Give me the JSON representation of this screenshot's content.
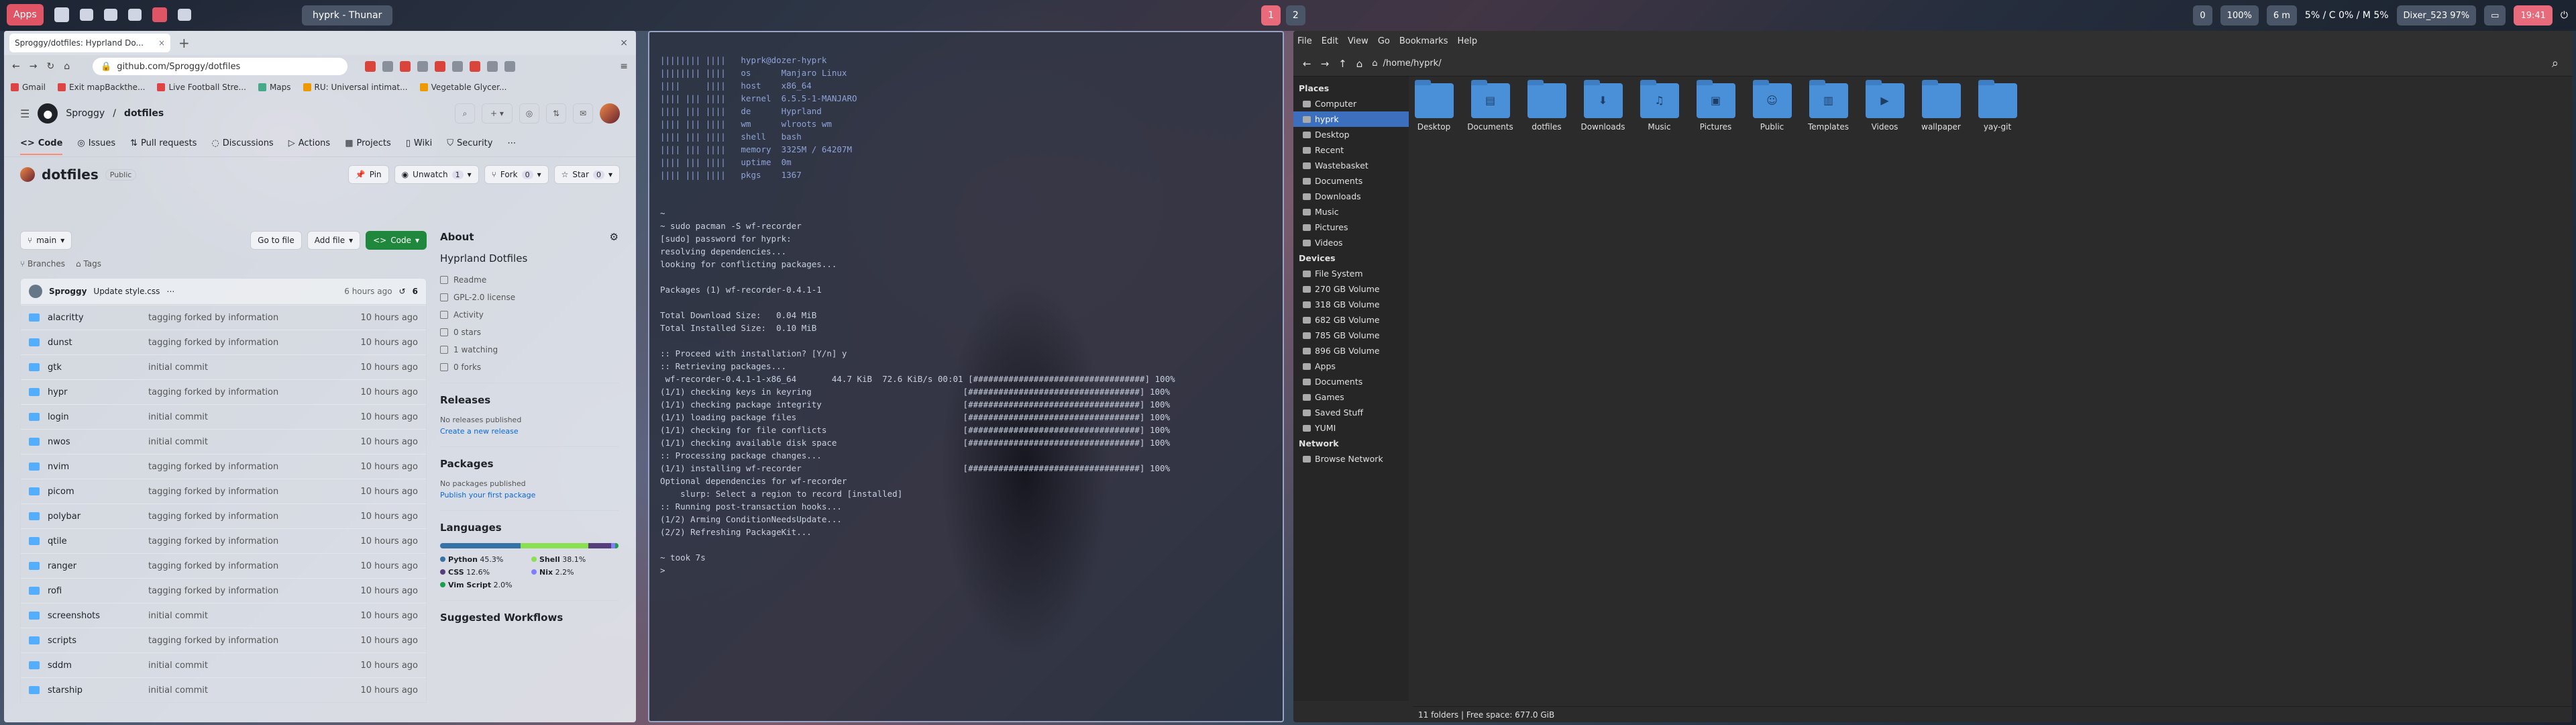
{
  "topbar": {
    "apps": "Apps",
    "window_title": "hyprk - Thunar",
    "workspace_pages": [
      "1",
      "2"
    ],
    "status_items": [
      "0",
      "100%",
      "6 m",
      "5% / C 0% / M 5%",
      "Dixer_523 97%"
    ],
    "clock": "19:41"
  },
  "browser": {
    "tab_title": "Sproggy/dotfiles: Hyprland Do...",
    "url": "github.com/Sproggy/dotfiles",
    "bookmarks": [
      "Gmail",
      "Exit mapBackthe...",
      "Live Football Stre...",
      "Maps",
      "RU: Universal intimat...",
      "Vegetable Glycer..."
    ],
    "gh": {
      "owner": "Sproggy",
      "repo": "dotfiles",
      "tabs": [
        "Code",
        "Issues",
        "Pull requests",
        "Discussions",
        "Actions",
        "Projects",
        "Wiki",
        "Security"
      ],
      "repo_title": "dotfiles",
      "visibility": "Public",
      "pin": "Pin",
      "unwatch": "Unwatch",
      "watch_count": "1",
      "fork": "Fork",
      "fork_count": "0",
      "star": "Star",
      "star_count": "0",
      "branch": "main",
      "branches": "Branches",
      "tags": "Tags",
      "goto_file": "Go to file",
      "add_file": "Add file",
      "code_btn": "Code",
      "commit": {
        "author": "Sproggy",
        "message": "Update style.css",
        "age": "6 hours ago",
        "count": "6"
      },
      "files": [
        {
          "name": "alacritty",
          "msg": "tagging forked by information",
          "age": "10 hours ago"
        },
        {
          "name": "dunst",
          "msg": "tagging forked by information",
          "age": "10 hours ago"
        },
        {
          "name": "gtk",
          "msg": "initial commit",
          "age": "10 hours ago"
        },
        {
          "name": "hypr",
          "msg": "tagging forked by information",
          "age": "10 hours ago"
        },
        {
          "name": "login",
          "msg": "initial commit",
          "age": "10 hours ago"
        },
        {
          "name": "nwos",
          "msg": "initial commit",
          "age": "10 hours ago"
        },
        {
          "name": "nvim",
          "msg": "tagging forked by information",
          "age": "10 hours ago"
        },
        {
          "name": "picom",
          "msg": "tagging forked by information",
          "age": "10 hours ago"
        },
        {
          "name": "polybar",
          "msg": "tagging forked by information",
          "age": "10 hours ago"
        },
        {
          "name": "qtile",
          "msg": "tagging forked by information",
          "age": "10 hours ago"
        },
        {
          "name": "ranger",
          "msg": "tagging forked by information",
          "age": "10 hours ago"
        },
        {
          "name": "rofi",
          "msg": "tagging forked by information",
          "age": "10 hours ago"
        },
        {
          "name": "screenshots",
          "msg": "initial commit",
          "age": "10 hours ago"
        },
        {
          "name": "scripts",
          "msg": "tagging forked by information",
          "age": "10 hours ago"
        },
        {
          "name": "sddm",
          "msg": "initial commit",
          "age": "10 hours ago"
        },
        {
          "name": "starship",
          "msg": "initial commit",
          "age": "10 hours ago"
        }
      ],
      "about": {
        "title": "About",
        "desc": "Hyprland Dotfiles",
        "readme": "Readme",
        "license": "GPL-2.0 license",
        "activity": "Activity",
        "stars": "0 stars",
        "watching": "1 watching",
        "forks": "0 forks"
      },
      "releases": {
        "title": "Releases",
        "none": "No releases published",
        "create": "Create a new release"
      },
      "packages": {
        "title": "Packages",
        "none": "No packages published",
        "publish": "Publish your first package"
      },
      "languages": {
        "title": "Languages",
        "items": [
          {
            "name": "Python",
            "pct": "45.3%",
            "value": 45.3,
            "color": "#3572A5"
          },
          {
            "name": "Shell",
            "pct": "38.1%",
            "value": 38.1,
            "color": "#89e051"
          },
          {
            "name": "CSS",
            "pct": "12.6%",
            "value": 12.6,
            "color": "#563d7c"
          },
          {
            "name": "Nix",
            "pct": "2.2%",
            "value": 2.2,
            "color": "#7e7eff"
          },
          {
            "name": "Vim Script",
            "pct": "2.0%",
            "value": 2.0,
            "color": "#199f4b"
          }
        ]
      },
      "suggested": "Suggested Workflows"
    }
  },
  "terminal": {
    "neofetch": [
      "|||||||| ||||   hyprk@dozer-hyprk",
      "|||||||| ||||   os      Manjaro Linux",
      "||||     ||||   host    x86_64",
      "|||| ||| ||||   kernel  6.5.5-1-MANJARO",
      "|||| ||| ||||   de      Hyprland",
      "|||| ||| ||||   wm      wlroots wm",
      "|||| ||| ||||   shell   bash",
      "|||| ||| ||||   memory  3325M / 64207M",
      "|||| ||| ||||   uptime  0m",
      "|||| ||| ||||   pkgs    1367"
    ],
    "lines": [
      "~",
      "~ sudo pacman -S wf-recorder",
      "[sudo] password for hyprk:",
      "resolving dependencies...",
      "looking for conflicting packages...",
      "",
      "Packages (1) wf-recorder-0.4.1-1",
      "",
      "Total Download Size:   0.04 MiB",
      "Total Installed Size:  0.10 MiB",
      "",
      ":: Proceed with installation? [Y/n] y",
      ":: Retrieving packages...",
      " wf-recorder-0.4.1-1-x86_64       44.7 KiB  72.6 KiB/s 00:01 [##################################] 100%",
      "(1/1) checking keys in keyring                              [##################################] 100%",
      "(1/1) checking package integrity                            [##################################] 100%",
      "(1/1) loading package files                                 [##################################] 100%",
      "(1/1) checking for file conflicts                           [##################################] 100%",
      "(1/1) checking available disk space                         [##################################] 100%",
      ":: Processing package changes...",
      "(1/1) installing wf-recorder                                [##################################] 100%",
      "Optional dependencies for wf-recorder",
      "    slurp: Select a region to record [installed]",
      ":: Running post-transaction hooks...",
      "(1/2) Arming ConditionNeedsUpdate...",
      "(2/2) Refreshing PackageKit...",
      "",
      "~ took 7s",
      "> "
    ]
  },
  "filemgr": {
    "menu": [
      "File",
      "Edit",
      "View",
      "Go",
      "Bookmarks",
      "Help"
    ],
    "path": "/home/hyprk/",
    "places_title": "Places",
    "places": [
      "Computer",
      "hyprk",
      "Desktop",
      "Recent",
      "Wastebasket",
      "Documents",
      "Downloads",
      "Music",
      "Pictures",
      "Videos"
    ],
    "devices_title": "Devices",
    "devices": [
      "File System",
      "270 GB Volume",
      "318 GB Volume",
      "682 GB Volume",
      "785 GB Volume",
      "896 GB Volume",
      "Apps",
      "Documents",
      "Games",
      "Saved Stuff",
      "YUMI"
    ],
    "network_title": "Network",
    "network": [
      "Browse Network"
    ],
    "folders": [
      {
        "name": "Desktop",
        "glyph": ""
      },
      {
        "name": "Documents",
        "glyph": "▤"
      },
      {
        "name": "dotfiles",
        "glyph": ""
      },
      {
        "name": "Downloads",
        "glyph": "⬇"
      },
      {
        "name": "Music",
        "glyph": "♫"
      },
      {
        "name": "Pictures",
        "glyph": "▣"
      },
      {
        "name": "Public",
        "glyph": "☺"
      },
      {
        "name": "Templates",
        "glyph": "▥"
      },
      {
        "name": "Videos",
        "glyph": "▶"
      },
      {
        "name": "wallpaper",
        "glyph": ""
      },
      {
        "name": "yay-git",
        "glyph": ""
      }
    ],
    "status": "11 folders  |  Free space: 677.0 GiB"
  }
}
